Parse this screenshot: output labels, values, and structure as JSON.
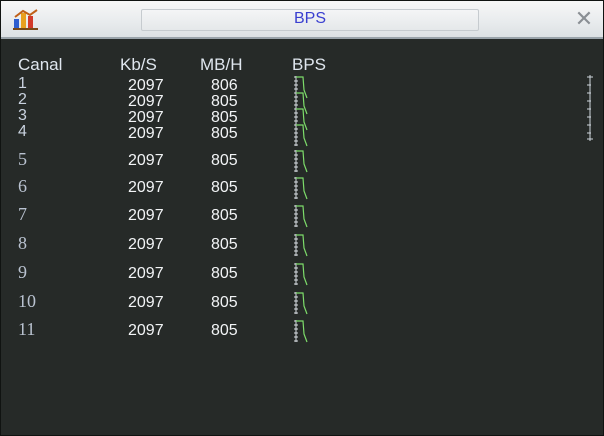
{
  "window": {
    "title": "BPS"
  },
  "columns": {
    "channel": "Canal",
    "kbs": "Kb/S",
    "mbh": "MB/H",
    "bps": "BPS"
  },
  "rows": [
    {
      "channel": "1",
      "kbs": "2097",
      "mbh": "806"
    },
    {
      "channel": "2",
      "kbs": "2097",
      "mbh": "805"
    },
    {
      "channel": "3",
      "kbs": "2097",
      "mbh": "805"
    },
    {
      "channel": "4",
      "kbs": "2097",
      "mbh": "805"
    },
    {
      "channel": "5",
      "kbs": "2097",
      "mbh": "805"
    },
    {
      "channel": "6",
      "kbs": "2097",
      "mbh": "805"
    },
    {
      "channel": "7",
      "kbs": "2097",
      "mbh": "805"
    },
    {
      "channel": "8",
      "kbs": "2097",
      "mbh": "805"
    },
    {
      "channel": "9",
      "kbs": "2097",
      "mbh": "805"
    },
    {
      "channel": "10",
      "kbs": "2097",
      "mbh": "805"
    },
    {
      "channel": "11",
      "kbs": "2097",
      "mbh": "805"
    }
  ],
  "colors": {
    "sparkline": "#7ddc6a",
    "axis": "#d8dde2",
    "title": "#3a3fd0"
  },
  "icons": {
    "app": "bar-chart-app-icon",
    "close": "close-icon"
  }
}
